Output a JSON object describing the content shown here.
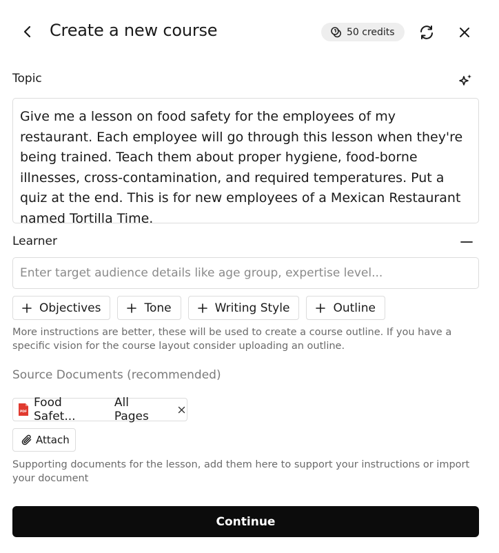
{
  "header": {
    "title": "Create a new course",
    "credits": "50 credits",
    "icons": {
      "back": "chevron-left-icon",
      "credits": "coins-icon",
      "refresh": "refresh-icon",
      "close": "close-icon"
    }
  },
  "topic": {
    "label": "Topic",
    "value": "Give me a lesson on food safety for the employees of my restaurant. Each employee will go through this lesson when they're being trained. Teach them about proper hygiene, food-borne illnesses, cross-contamination, and required temperatures. Put a quiz at the end. This is for new employees of a Mexican Restaurant named Tortilla Time.",
    "icon": "sparkle-icon"
  },
  "learner": {
    "label": "Learner",
    "placeholder": "Enter target audience details like age group, expertise level...",
    "value": "",
    "icon": "minus-icon"
  },
  "chips": [
    {
      "label": "Objectives"
    },
    {
      "label": "Tone"
    },
    {
      "label": "Writing Style"
    },
    {
      "label": "Outline"
    }
  ],
  "instructions_help": "More instructions are better, these will be used to create a course outline. If you have a specific vision for the course layout consider uploading an outline.",
  "sources": {
    "label": "Source Documents (recommended)",
    "file": {
      "name": "Food Safet...",
      "pages": "All Pages",
      "icon": "pdf-icon"
    },
    "attach_label": "Attach",
    "help": "Supporting documents for the lesson, add them here to support your instructions or import your document"
  },
  "continue_label": "Continue",
  "colors": {
    "primary_button": "#0c0c0c",
    "credits_bg": "#eeeeee",
    "border": "#dcdcdc",
    "pdf_red": "#e03a2f"
  }
}
